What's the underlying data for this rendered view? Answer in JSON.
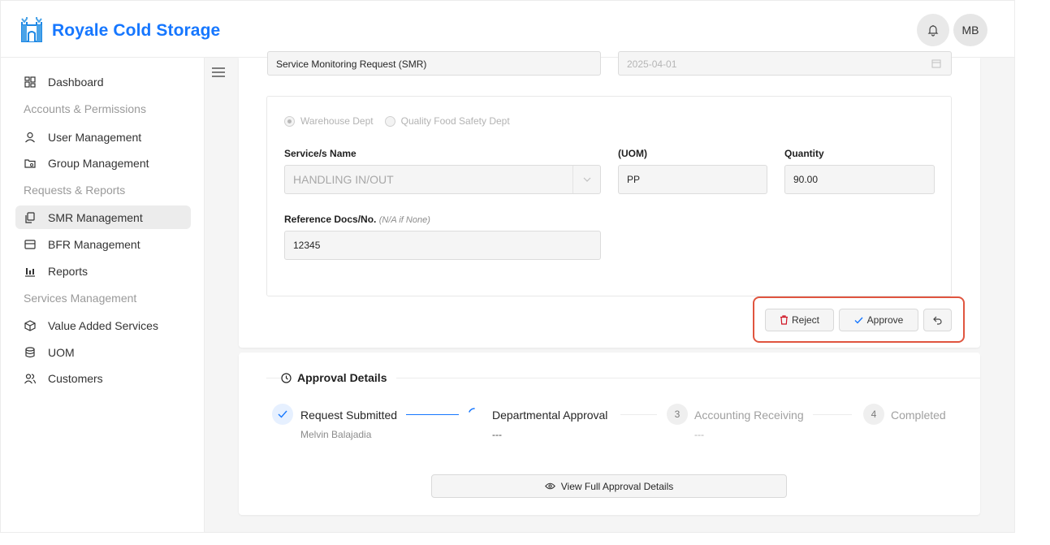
{
  "header": {
    "brand": "Royale Cold Storage",
    "avatar_initials": "MB",
    "accent": "#1677ff"
  },
  "sidebar": {
    "items": [
      {
        "type": "item",
        "label": "Dashboard",
        "icon": "grid-icon"
      },
      {
        "type": "group",
        "label": "Accounts & Permissions"
      },
      {
        "type": "item",
        "label": "User Management",
        "icon": "user-icon"
      },
      {
        "type": "item",
        "label": "Group Management",
        "icon": "folder-icon"
      },
      {
        "type": "group",
        "label": "Requests & Reports"
      },
      {
        "type": "item",
        "label": "SMR Management",
        "icon": "copy-icon",
        "active": true
      },
      {
        "type": "item",
        "label": "BFR Management",
        "icon": "inbox-icon"
      },
      {
        "type": "item",
        "label": "Reports",
        "icon": "bar-chart-icon"
      },
      {
        "type": "group",
        "label": "Services Management"
      },
      {
        "type": "item",
        "label": "Value Added Services",
        "icon": "box-icon"
      },
      {
        "type": "item",
        "label": "UOM",
        "icon": "database-icon"
      },
      {
        "type": "item",
        "label": "Customers",
        "icon": "users-icon"
      }
    ]
  },
  "form": {
    "request_type": "Service Monitoring Request (SMR)",
    "date": "2025-04-01",
    "radio_options": [
      {
        "label": "Warehouse Dept",
        "selected": true
      },
      {
        "label": "Quality Food Safety Dept",
        "selected": false
      }
    ],
    "service_label": "Service/s Name",
    "service_value": "HANDLING IN/OUT",
    "uom_label": "(UOM)",
    "uom_value": "PP",
    "quantity_label": "Quantity",
    "quantity_value": "90.00",
    "reference_label": "Reference Docs/No.",
    "reference_hint": "(N/A if None)",
    "reference_value": "12345"
  },
  "actions": {
    "reject": "Reject",
    "approve": "Approve",
    "reject_color": "#cf1322",
    "highlight_color": "#e0553f"
  },
  "approval": {
    "title": "Approval Details",
    "steps": [
      {
        "label": "Request Submitted",
        "sub": "Melvin Balajadia",
        "state": "done"
      },
      {
        "label": "Departmental Approval",
        "sub": "---",
        "state": "in-progress"
      },
      {
        "label": "Accounting Receiving",
        "sub": "---",
        "state": "pending",
        "number": "3"
      },
      {
        "label": "Completed",
        "sub": "",
        "state": "pending",
        "number": "4"
      }
    ],
    "view_button": "View Full Approval Details"
  }
}
